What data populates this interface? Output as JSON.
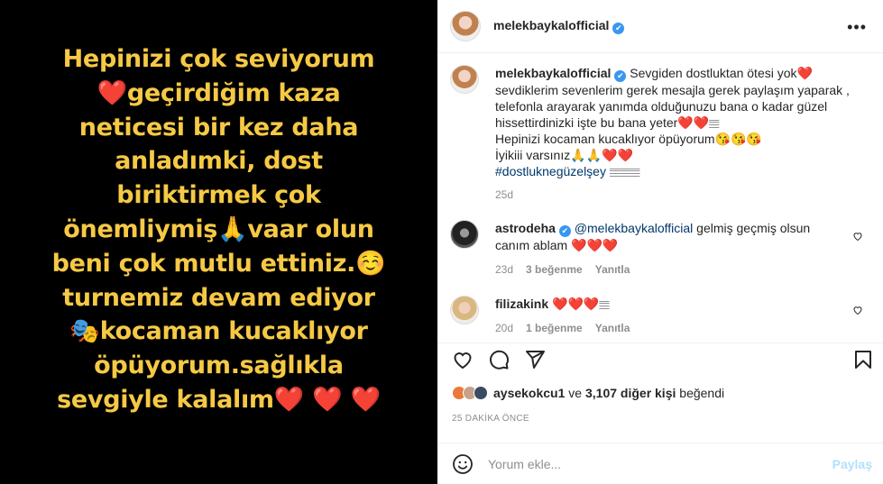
{
  "media": {
    "lines": [
      "Hepinizi çok seviyorum",
      "❤️geçirdiğim kaza",
      "neticesi bir kez daha",
      "anladımki, dost",
      "biriktirmek çok",
      "önemliymiş🙏vaar olun",
      "beni çok mutlu ettiniz.☺️",
      "turnemiz devam ediyor",
      "🎭kocaman kucaklıyor",
      "öpüyorum.sağlıkla",
      "sevgiyle kalalım❤️ ❤️ ❤️"
    ]
  },
  "header": {
    "username": "melekbaykalofficial",
    "verified_icon": "✔",
    "more_icon": "•••"
  },
  "caption": {
    "username": "melekbaykalofficial",
    "text_1": "Sevgiden dostluktan ötesi yok❤️",
    "text_2": "sevdiklerim sevenlerim gerek mesajla gerek paylaşım yaparak ,",
    "text_3": "telefonla arayarak yanımda olduğunuzu bana o kadar güzel",
    "text_4": "hissettirdinizki işte bu bana yeter❤️❤️𝄙",
    "text_5": "Hepinizi kocaman kucaklıyor öpüyorum😘😘😘",
    "text_6": "İyikiii varsınız🙏🙏❤️❤️",
    "hashtag": "#dostluknegüzelşey",
    "hashtag_tail": "𝄙𝄙𝄙",
    "time": "25d"
  },
  "comments": [
    {
      "username": "astrodeha",
      "mention": "@melekbaykalofficial",
      "text": "gelmiş geçmiş olsun",
      "text_2": "canım ablam ❤️❤️❤️",
      "time": "23d",
      "likes": "3 beğenme",
      "reply": "Yanıtla"
    },
    {
      "username": "filizakink",
      "text": "❤️❤️❤️𝄙",
      "time": "20d",
      "likes": "1 beğenme",
      "reply": "Yanıtla"
    }
  ],
  "likes": {
    "user": "aysekokcu1",
    "conj": "ve",
    "count": "3,107 diğer kişi",
    "suffix": "beğendi"
  },
  "posted": "25 DAKİKA ÖNCE",
  "add_comment": {
    "placeholder": "Yorum ekle...",
    "post_label": "Paylaş"
  },
  "colors": {
    "accent": "#0095f6",
    "story_text": "#f6c945",
    "heart": "#ed1c24",
    "muted": "#8e8e8e"
  }
}
